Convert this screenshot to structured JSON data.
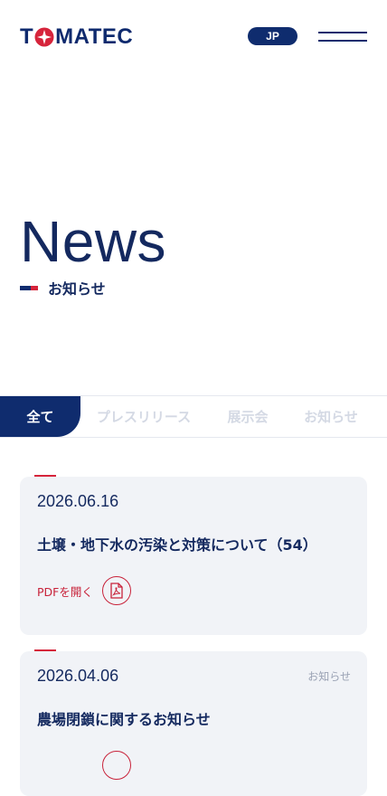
{
  "header": {
    "logo_left": "T",
    "logo_right": "MATEC",
    "lang": "JP"
  },
  "hero": {
    "title": "News",
    "subtitle": "お知らせ"
  },
  "tabs": [
    {
      "label": "全て",
      "active": true
    },
    {
      "label": "プレスリリース",
      "active": false
    },
    {
      "label": "展示会",
      "active": false
    },
    {
      "label": "お知らせ",
      "active": false
    }
  ],
  "news": [
    {
      "date": "2026.06.16",
      "category": "",
      "title": "土壌・地下水の汚染と対策について（54）",
      "pdf_label": "PDFを開く"
    },
    {
      "date": "2026.04.06",
      "category": "お知らせ",
      "title": "農場閉鎖に関するお知らせ",
      "pdf_label": ""
    }
  ],
  "colors": {
    "navy": "#0f2c6e",
    "red": "#d6243b",
    "card_bg": "#f1f3f7"
  }
}
